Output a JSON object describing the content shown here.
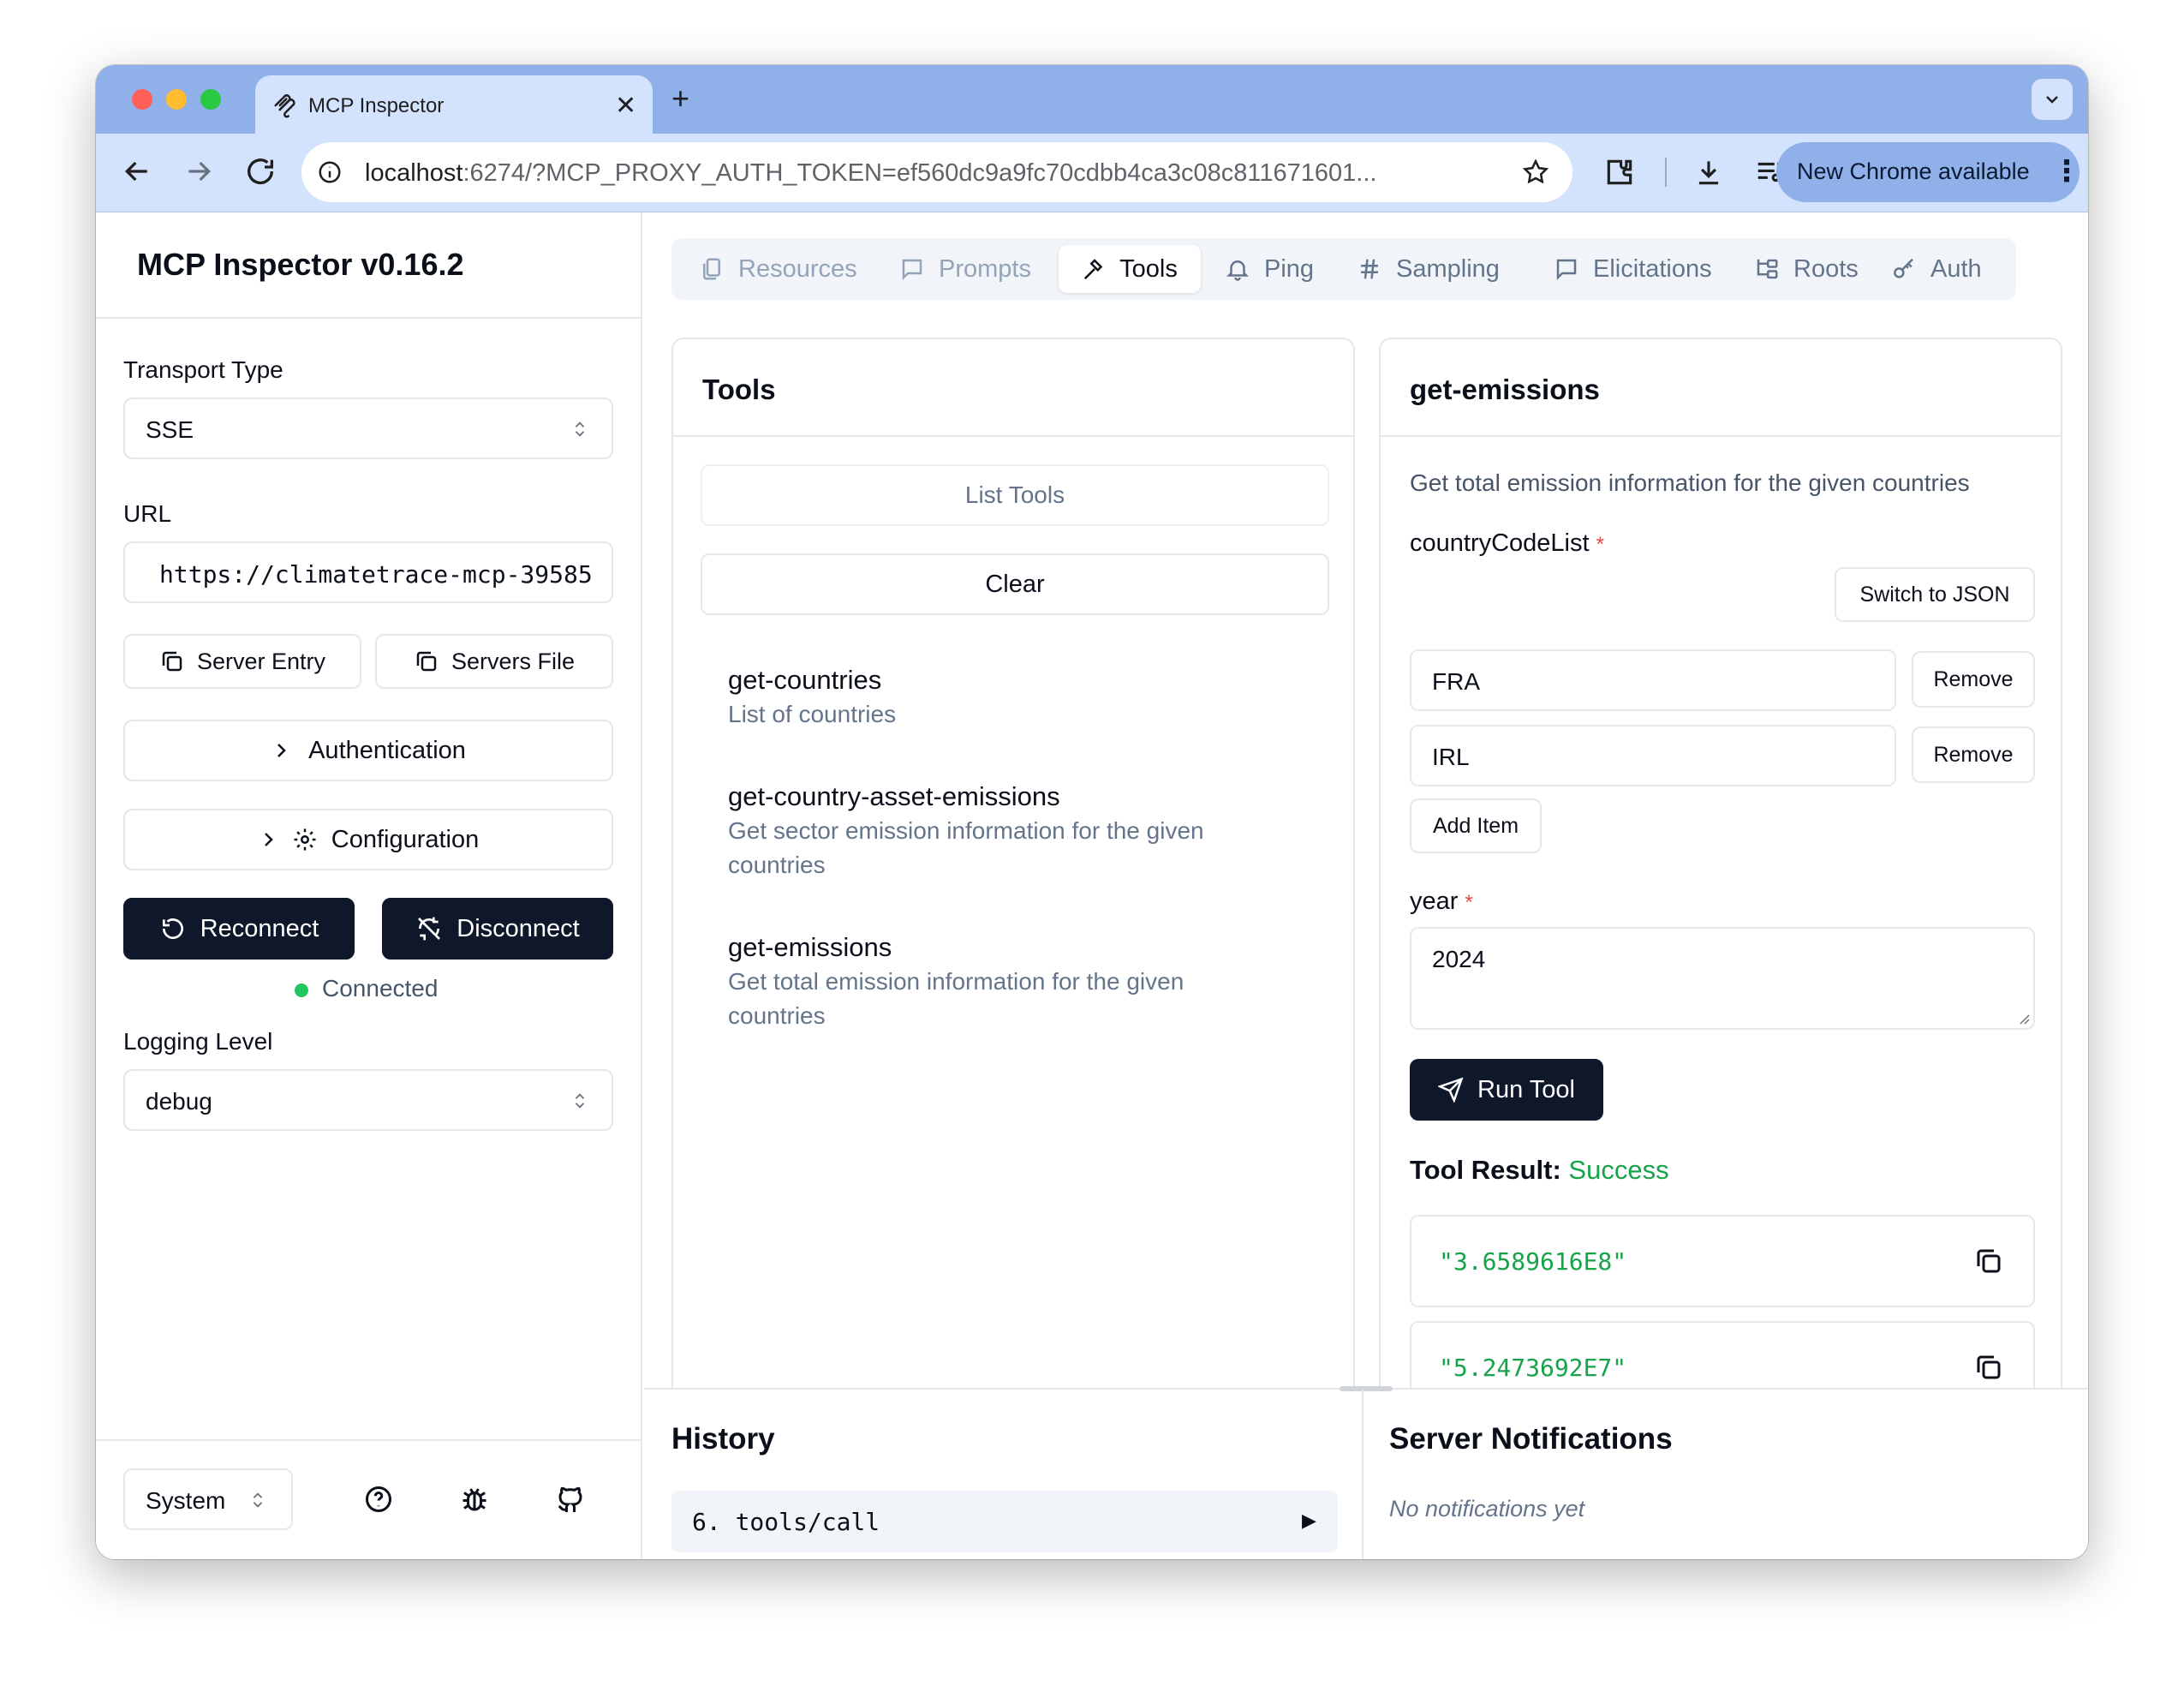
{
  "browser": {
    "tab_title": "MCP Inspector",
    "url_host": "localhost",
    "url_rest": ":6274/?MCP_PROXY_AUTH_TOKEN=ef560dc9a9fc70cdbb4ca3c08c811671601...",
    "update_label": "New Chrome available"
  },
  "sidebar": {
    "title": "MCP Inspector v0.16.2",
    "transport_label": "Transport Type",
    "transport_value": "SSE",
    "url_label": "URL",
    "url_value": "https://climatetrace-mcp-39585",
    "server_entry_label": "Server Entry",
    "servers_file_label": "Servers File",
    "authentication_label": "Authentication",
    "configuration_label": "Configuration",
    "reconnect_label": "Reconnect",
    "disconnect_label": "Disconnect",
    "status_label": "Connected",
    "status_color": "#22c55e",
    "logging_label": "Logging Level",
    "logging_value": "debug",
    "theme_value": "System"
  },
  "tabs": [
    {
      "label": "Resources",
      "icon": "files-icon"
    },
    {
      "label": "Prompts",
      "icon": "message-square-icon"
    },
    {
      "label": "Tools",
      "icon": "hammer-icon",
      "active": true
    },
    {
      "label": "Ping",
      "icon": "bell-icon"
    },
    {
      "label": "Sampling",
      "icon": "hash-icon"
    },
    {
      "label": "Elicitations",
      "icon": "message-square-icon"
    },
    {
      "label": "Roots",
      "icon": "folder-tree-icon"
    },
    {
      "label": "Auth",
      "icon": "key-icon"
    }
  ],
  "tools_panel": {
    "title": "Tools",
    "list_button": "List Tools",
    "clear_button": "Clear",
    "items": [
      {
        "name": "get-countries",
        "description_lines": [
          "List of countries"
        ]
      },
      {
        "name": "get-country-asset-emissions",
        "description_lines": [
          "Get sector emission information for the given",
          "countries"
        ]
      },
      {
        "name": "get-emissions",
        "description_lines": [
          "Get total emission information for the given",
          "countries"
        ]
      }
    ]
  },
  "detail_panel": {
    "title": "get-emissions",
    "description": "Get total emission information for the given countries",
    "param1_label": "countryCodeList",
    "switch_json_label": "Switch to JSON",
    "items": [
      "FRA",
      "IRL"
    ],
    "remove_label": "Remove",
    "add_item_label": "Add Item",
    "param2_label": "year",
    "year_value": "2024",
    "required_mark": "*",
    "run_label": "Run Tool",
    "result_label": "Tool Result:",
    "result_status": "Success",
    "results": [
      "\"3.6589616E8\"",
      "\"5.2473692E7\""
    ]
  },
  "history": {
    "title": "History",
    "entry": "6. tools/call",
    "expand_glyph": "▶"
  },
  "notifications": {
    "title": "Server Notifications",
    "empty": "No notifications yet"
  }
}
